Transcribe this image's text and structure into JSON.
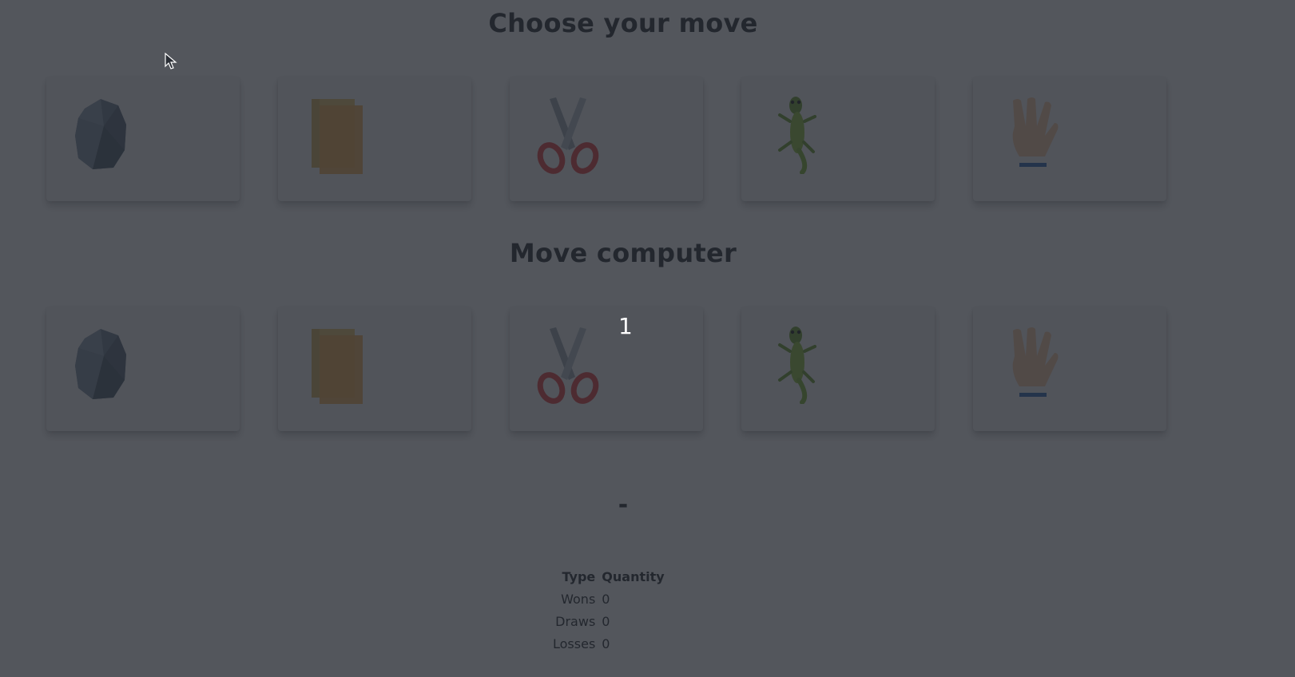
{
  "player_section": {
    "title": "Choose your move",
    "moves": [
      {
        "name": "rock",
        "icon": "rock-icon"
      },
      {
        "name": "paper",
        "icon": "paper-icon"
      },
      {
        "name": "scissors",
        "icon": "scissors-icon"
      },
      {
        "name": "lizard",
        "icon": "lizard-icon"
      },
      {
        "name": "spock",
        "icon": "spock-hand-icon"
      }
    ]
  },
  "computer_section": {
    "title": "Move computer",
    "moves": [
      {
        "name": "rock",
        "icon": "rock-icon"
      },
      {
        "name": "paper",
        "icon": "paper-icon"
      },
      {
        "name": "scissors",
        "icon": "scissors-icon"
      },
      {
        "name": "lizard",
        "icon": "lizard-icon"
      },
      {
        "name": "spock",
        "icon": "spock-hand-icon"
      }
    ]
  },
  "countdown": "1",
  "result": "-",
  "stats": {
    "headers": {
      "type": "Type",
      "quantity": "Quantity"
    },
    "rows": [
      {
        "type": "Wons",
        "quantity": "0"
      },
      {
        "type": "Draws",
        "quantity": "0"
      },
      {
        "type": "Losses",
        "quantity": "0"
      }
    ]
  },
  "colors": {
    "overlay": "#22262e",
    "card_background": "#f3f4f6",
    "page_background": "#ffffff"
  }
}
